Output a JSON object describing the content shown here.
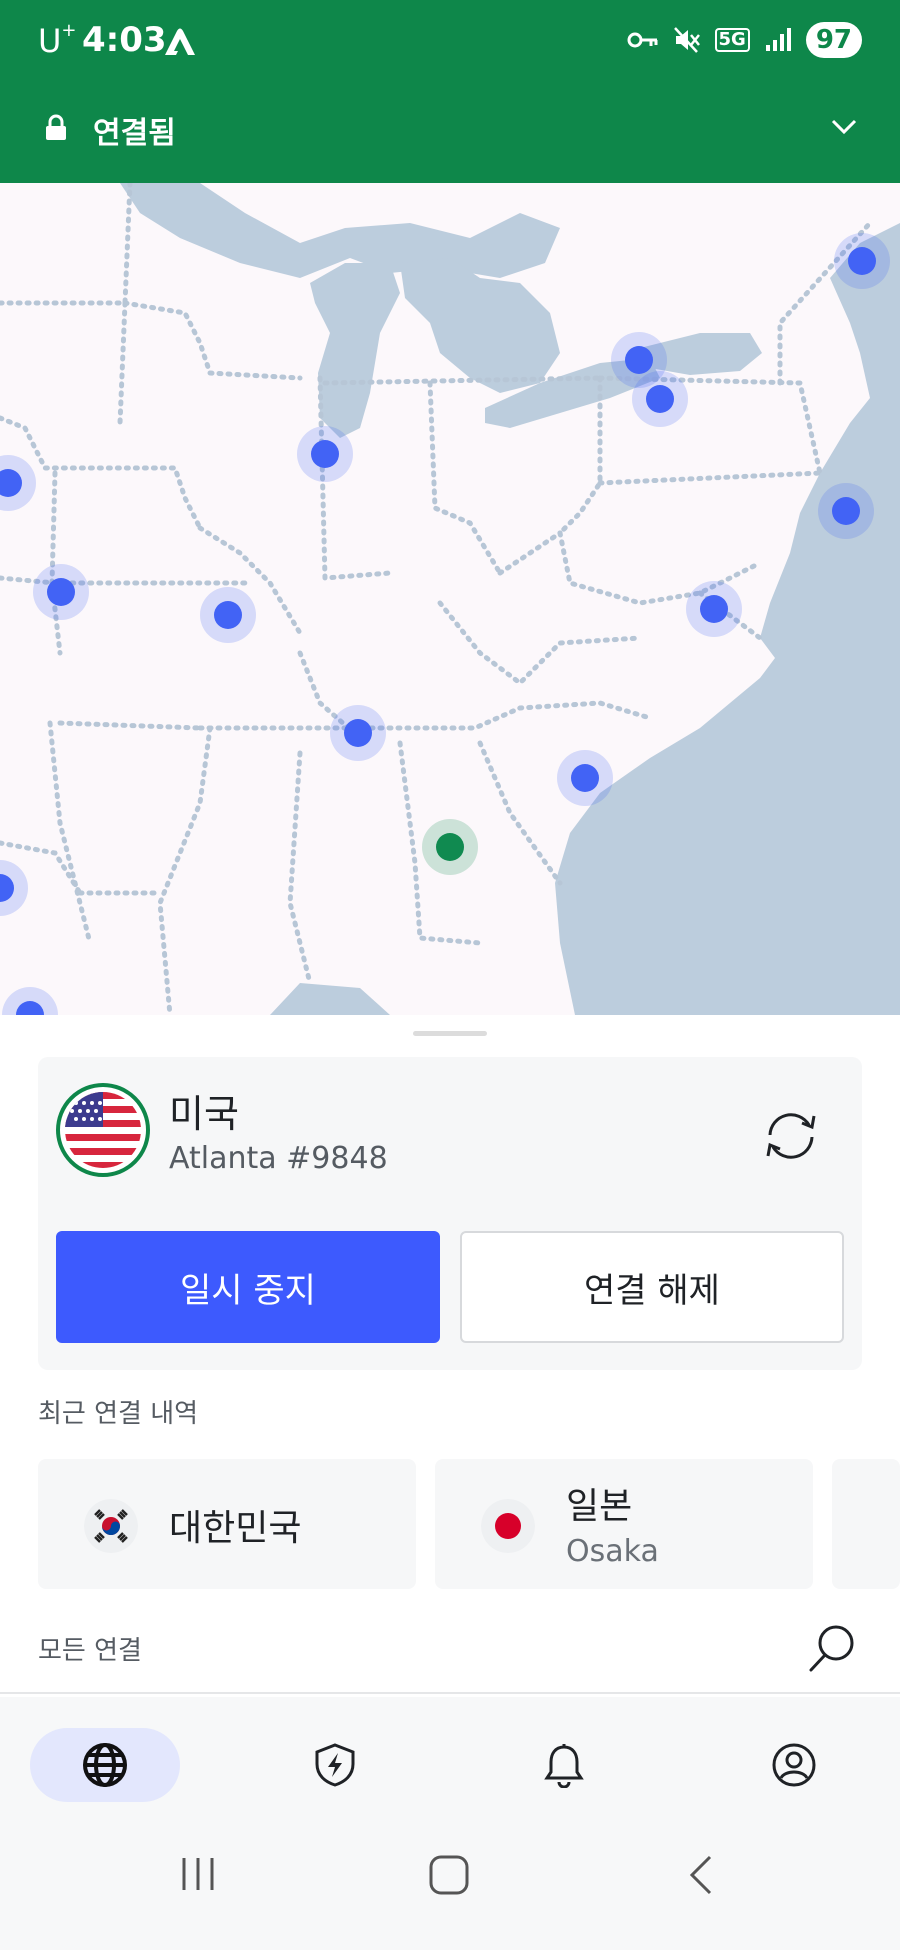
{
  "status_bar": {
    "carrier": "U",
    "carrier_sup": "+",
    "time": "4:03",
    "network": "5G",
    "battery": "97"
  },
  "header": {
    "connection_status": "연결됨"
  },
  "connection_card": {
    "country": "미국",
    "server": "Atlanta #9848",
    "pause_label": "일시 중지",
    "disconnect_label": "연결 해제"
  },
  "recent": {
    "title": "최근 연결 내역",
    "items": [
      {
        "country": "대한민국"
      },
      {
        "country": "일본",
        "city": "Osaka"
      }
    ]
  },
  "all_connections": {
    "title": "모든 연결"
  },
  "colors": {
    "brand_green": "#0e874a",
    "accent_blue": "#3d5afe",
    "server_dot": "#4263f5",
    "connected_dot": "#108a50",
    "water": "#bccddd"
  }
}
